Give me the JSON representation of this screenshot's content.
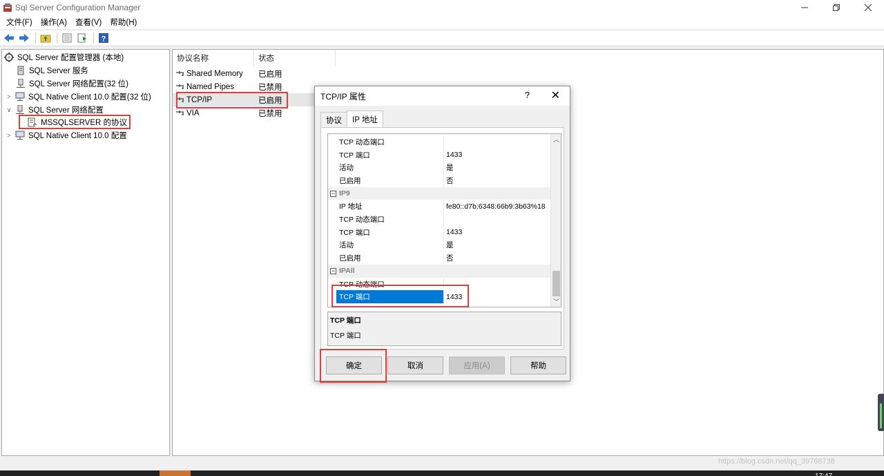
{
  "window": {
    "title": "Sql Server Configuration Manager",
    "minimize_icon": "minimize-icon",
    "restore_icon": "restore-icon",
    "close_icon": "close-icon"
  },
  "menu": [
    "文件(F)",
    "操作(A)",
    "查看(V)",
    "帮助(H)"
  ],
  "toolbar": [
    "back-arrow-icon",
    "forward-arrow-icon",
    "up-folder-icon",
    "properties-icon",
    "export-icon",
    "help-icon"
  ],
  "tree": {
    "items": [
      {
        "label": "SQL Server 配置管理器 (本地)",
        "icon": "config-manager-icon"
      },
      {
        "label": "SQL Server 服务",
        "icon": "server-icon"
      },
      {
        "label": "SQL Server 网络配置(32 位)",
        "icon": "network-icon"
      },
      {
        "label": "SQL Native Client 10.0 配置(32 位)",
        "icon": "client-icon",
        "expander": ">"
      },
      {
        "label": "SQL Server 网络配置",
        "icon": "network-icon",
        "expander": "∨"
      },
      {
        "label": "MSSQLSERVER 的协议",
        "icon": "protocol-icon"
      },
      {
        "label": "SQL Native Client 10.0 配置",
        "icon": "client-icon",
        "expander": ">"
      }
    ]
  },
  "list": {
    "headers": [
      "协议名称",
      "状态"
    ],
    "rows": [
      {
        "name": "Shared Memory",
        "status": "已启用"
      },
      {
        "name": "Named Pipes",
        "status": "已禁用"
      },
      {
        "name": "TCP/IP",
        "status": "已启用"
      },
      {
        "name": "VIA",
        "status": "已禁用"
      }
    ]
  },
  "dialog": {
    "title": "TCP/IP 属性",
    "help": "?",
    "close": "✕",
    "tabs": [
      "协议",
      "IP 地址"
    ],
    "active_tab": "IP 地址",
    "grid_rows": [
      {
        "key": "TCP 动态端口",
        "value": ""
      },
      {
        "key": "TCP 端口",
        "value": "1433"
      },
      {
        "key": "活动",
        "value": "是"
      },
      {
        "key": "已启用",
        "value": "否"
      },
      {
        "key": "IP9",
        "value": "",
        "category": true
      },
      {
        "key": "IP 地址",
        "value": "fe80::d7b:6348:66b9:3b63%18"
      },
      {
        "key": "TCP 动态端口",
        "value": ""
      },
      {
        "key": "TCP 端口",
        "value": "1433"
      },
      {
        "key": "活动",
        "value": "是"
      },
      {
        "key": "已启用",
        "value": "否"
      },
      {
        "key": "IPAll",
        "value": "",
        "category": true
      },
      {
        "key": "TCP 动态端口",
        "value": ""
      },
      {
        "key": "TCP 端口",
        "value": "1433",
        "selected": true
      }
    ],
    "description": {
      "title": "TCP 端口",
      "text": "TCP 端口"
    },
    "buttons": {
      "ok": "确定",
      "cancel": "取消",
      "apply": "应用(A)",
      "help": "帮助"
    }
  },
  "watermark": "https://blog.csdn.net/qq_39768738",
  "clock": "17:47",
  "colors": {
    "selection": "#0078d7",
    "highlight_box": "#e53b3b"
  }
}
